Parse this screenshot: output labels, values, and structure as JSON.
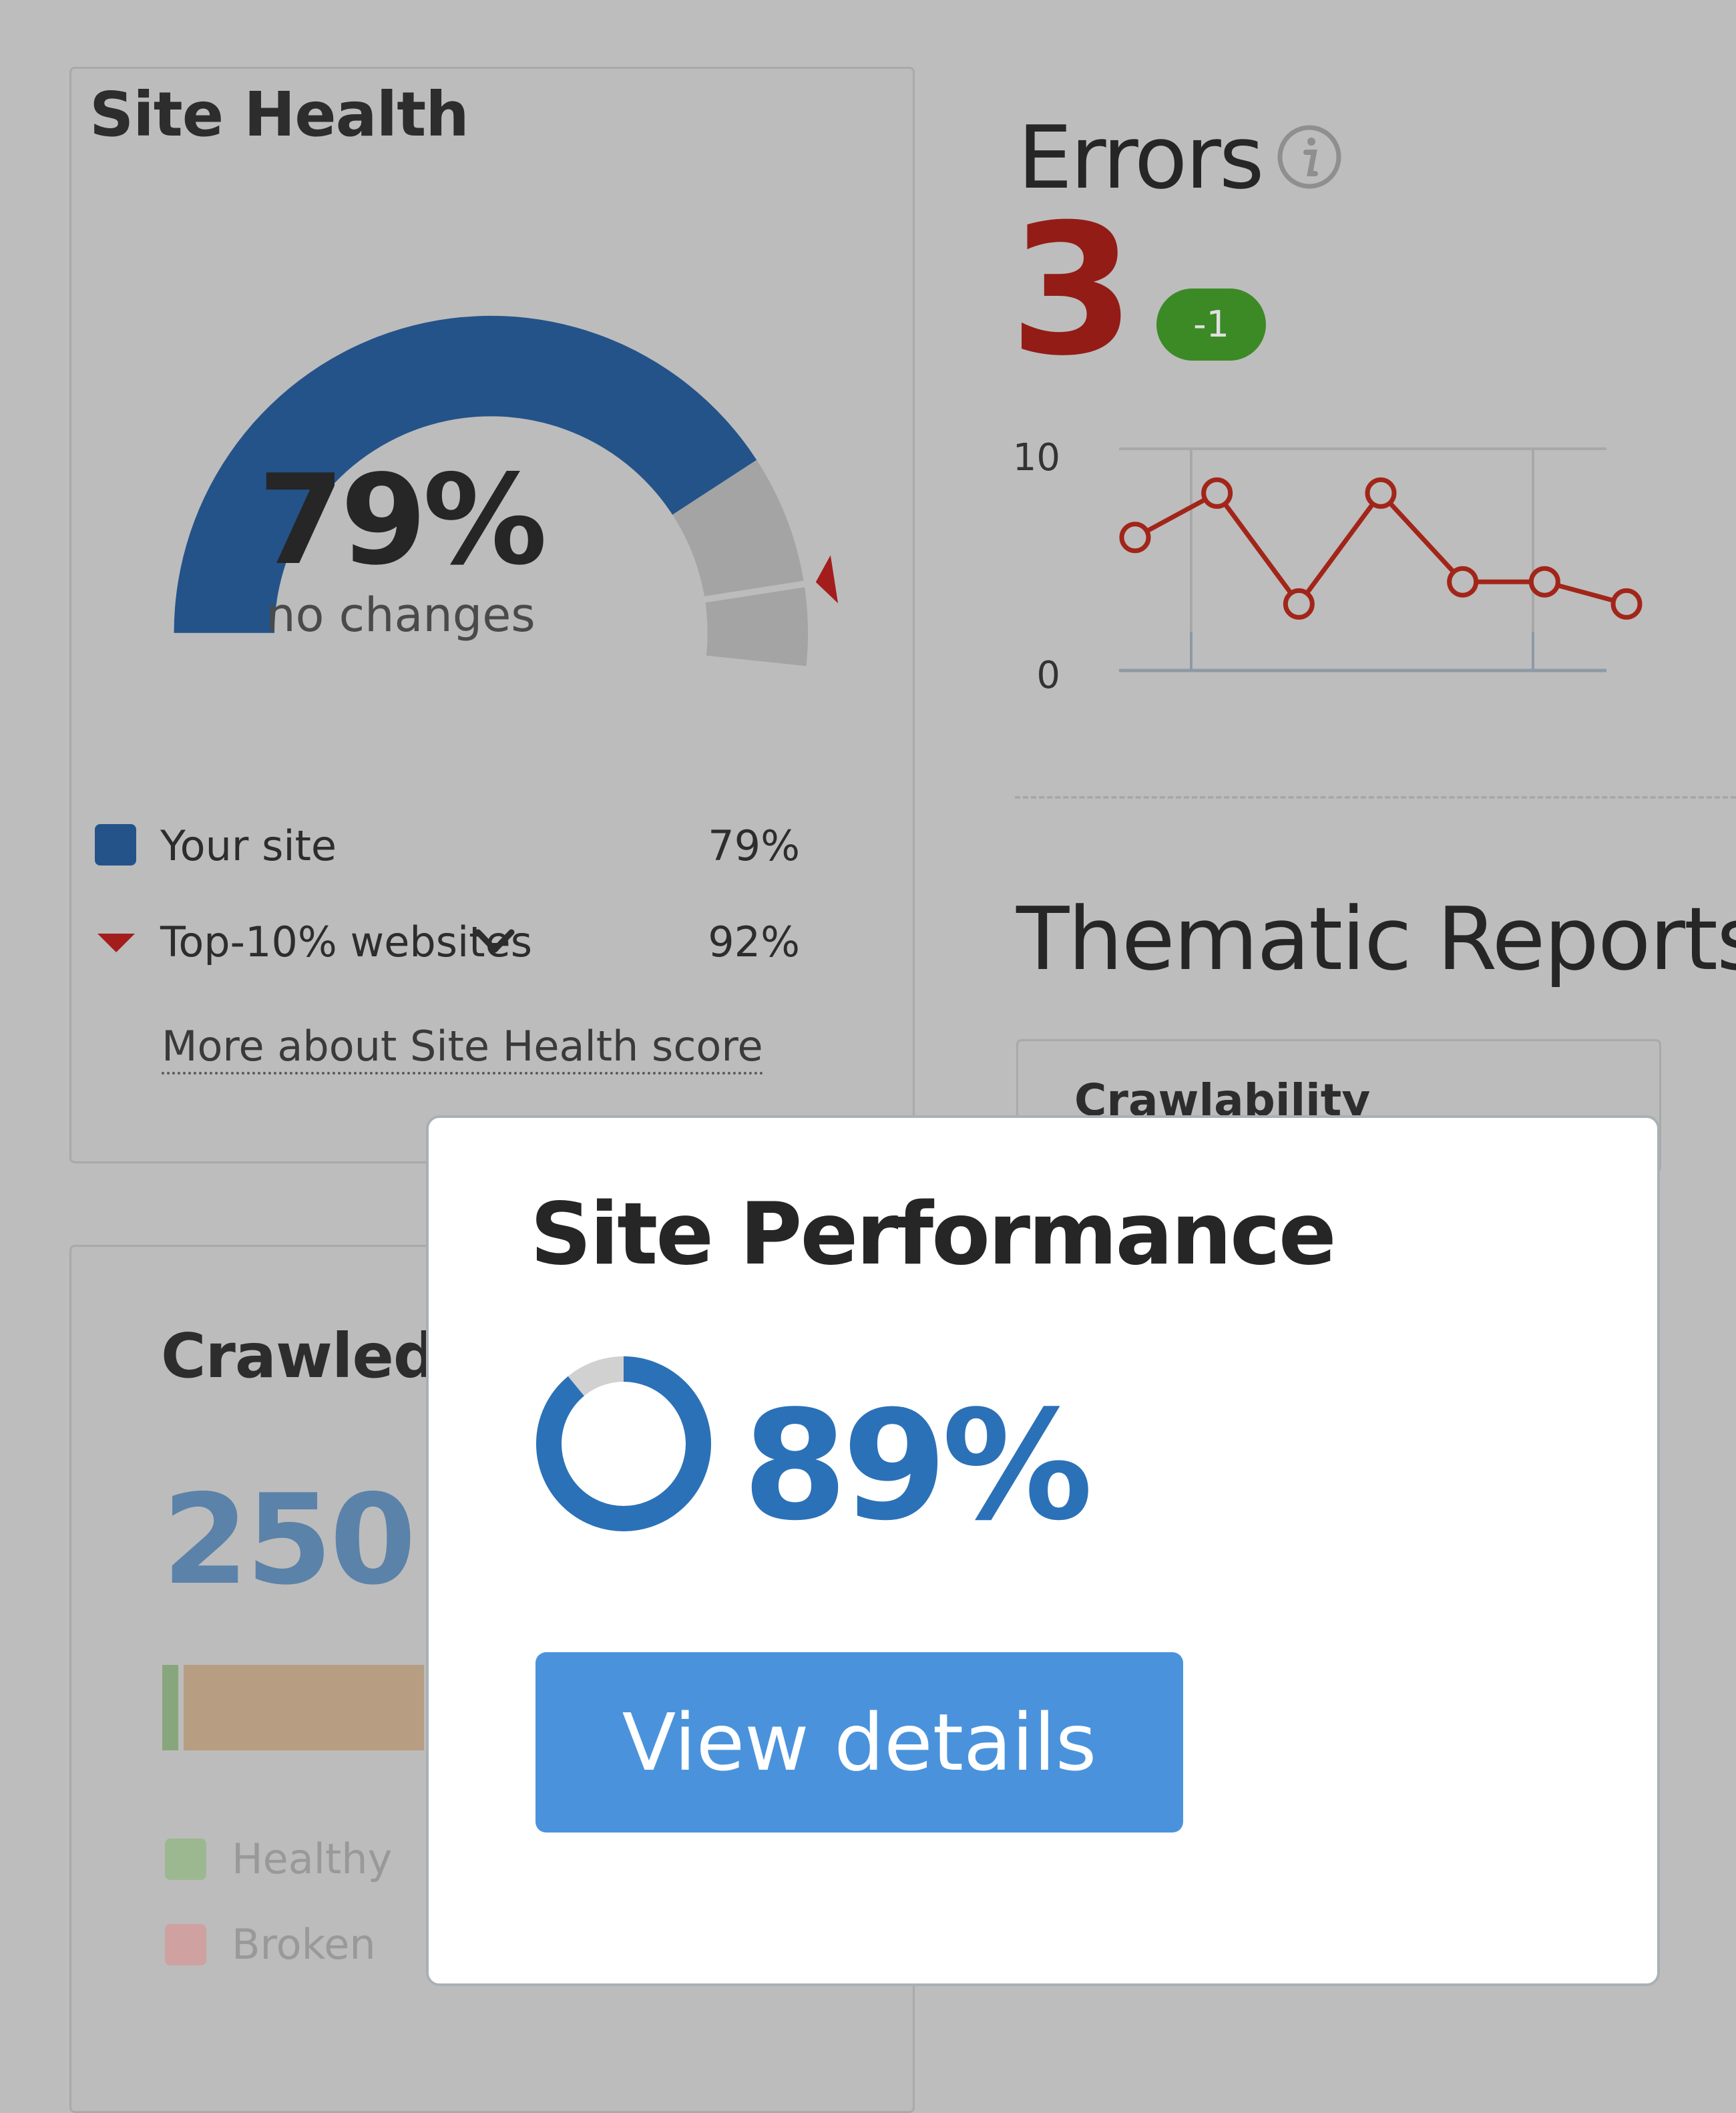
{
  "site_health": {
    "title": "Site Health",
    "score": "79%",
    "score_value": 79,
    "top10_value": 92,
    "change_text": "no changes",
    "legend": [
      {
        "label": "Your site",
        "value": "79%"
      },
      {
        "label": "Top-10% websites",
        "value": "92%"
      }
    ],
    "more_link": "More about Site Health score",
    "colors": {
      "your_site": "#245389",
      "remainder": "#a4a4a4",
      "marker": "#a31d1d"
    }
  },
  "errors": {
    "title": "Errors",
    "count": "3",
    "badge": "-1",
    "colors": {
      "count": "#931c16",
      "badge": "#3c8a26",
      "line": "#a22519"
    }
  },
  "chart_data": {
    "type": "line",
    "y_tick_labels": [
      "10",
      "0"
    ],
    "ylim": [
      0,
      10
    ],
    "series": [
      {
        "values": [
          6,
          8,
          3,
          8,
          4,
          4,
          3
        ]
      }
    ],
    "grid": true
  },
  "thematic_reports": {
    "title": "Thematic Reports",
    "first_card": "Crawlability"
  },
  "crawled": {
    "title": "Crawled",
    "count": "250",
    "legend": [
      {
        "label": "Healthy",
        "color": "#9cb891"
      },
      {
        "label": "Broken",
        "color": "#cfa1a1"
      }
    ]
  },
  "site_performance": {
    "title": "Site Performance",
    "score": "89%",
    "score_value": 89,
    "button": "View details",
    "colors": {
      "donut": "#2b71b8",
      "donut_rest": "#d1d1d1",
      "button": "#4a93dc"
    }
  }
}
